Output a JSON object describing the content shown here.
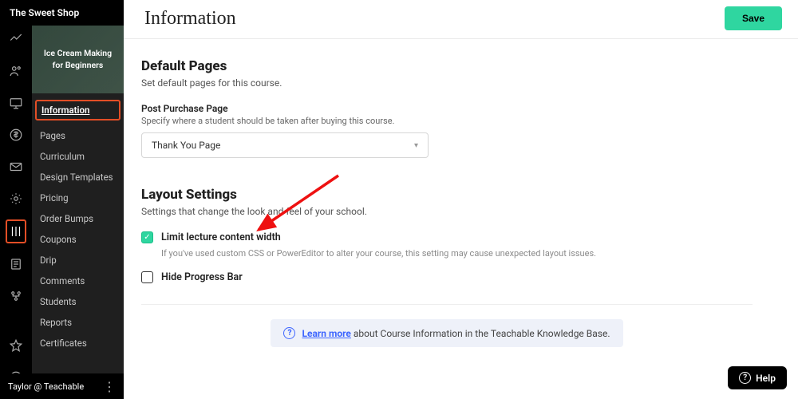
{
  "site": {
    "name": "The Sweet Shop"
  },
  "course": {
    "title": "Ice Cream Making for Beginners"
  },
  "sidebar": {
    "active": "Information",
    "items": [
      "Pages",
      "Curriculum",
      "Design Templates",
      "Pricing",
      "Order Bumps",
      "Coupons",
      "Drip",
      "Comments",
      "Students",
      "Reports",
      "Certificates"
    ]
  },
  "user": {
    "label": "Taylor @ Teachable"
  },
  "page": {
    "title": "Information",
    "save": "Save"
  },
  "default_pages": {
    "heading": "Default Pages",
    "desc": "Set default pages for this course.",
    "field_label": "Post Purchase Page",
    "field_help": "Specify where a student should be taken after buying this course.",
    "selected": "Thank You Page"
  },
  "layout": {
    "heading": "Layout Settings",
    "desc": "Settings that change the look and feel of your school.",
    "limit_label": "Limit lecture content width",
    "limit_note": "If you've used custom CSS or PowerEditor to alter your course, this setting may cause unexpected layout issues.",
    "hide_label": "Hide Progress Bar"
  },
  "kb": {
    "link": "Learn more",
    "rest": " about Course Information in the Teachable Knowledge Base."
  },
  "help": {
    "label": "Help"
  }
}
